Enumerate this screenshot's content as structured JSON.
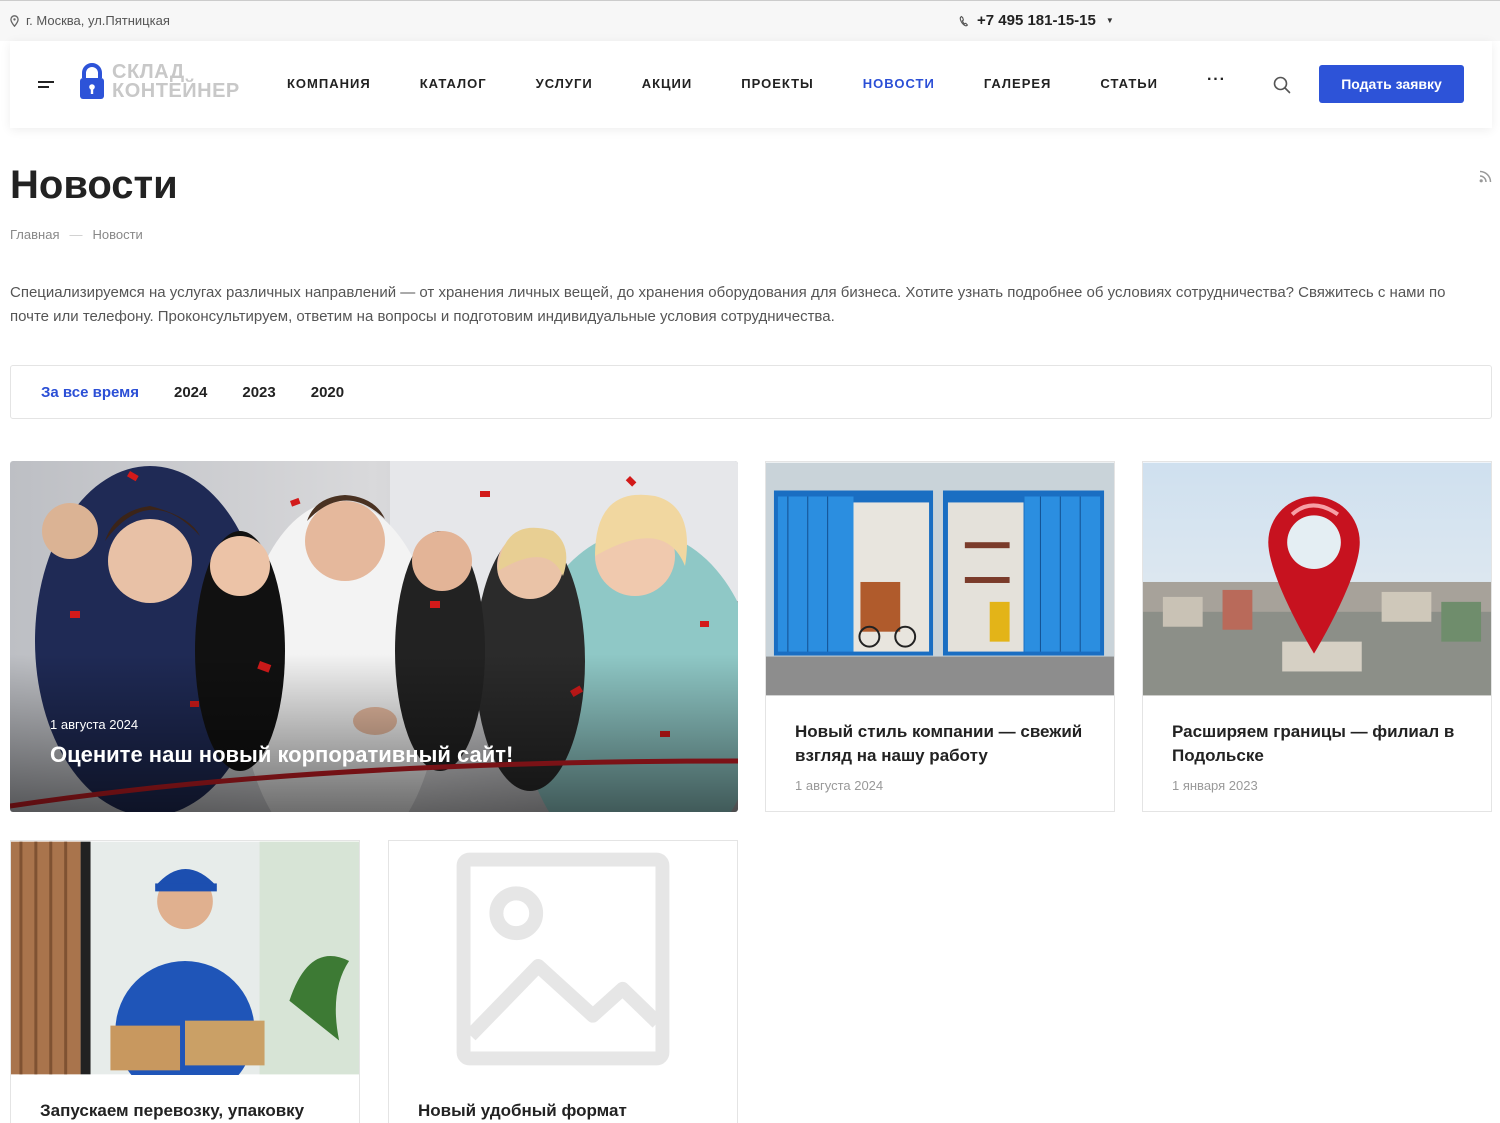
{
  "topbar": {
    "address": "г. Москва, ул.Пятницкая",
    "phone": "+7 495 181-15-15"
  },
  "header": {
    "logo_line1": "СКЛАД",
    "logo_line2": "КОНТЕЙНЕР",
    "nav": [
      {
        "label": "КОМПАНИЯ"
      },
      {
        "label": "КАТАЛОГ"
      },
      {
        "label": "УСЛУГИ"
      },
      {
        "label": "АКЦИИ"
      },
      {
        "label": "ПРОЕКТЫ"
      },
      {
        "label": "НОВОСТИ",
        "active": true
      },
      {
        "label": "ГАЛЕРЕЯ"
      },
      {
        "label": "СТАТЬИ"
      }
    ],
    "more_label": "···",
    "cta_label": "Подать заявку",
    "accent_color": "#2d53d8"
  },
  "page": {
    "title": "Новости",
    "breadcrumb": {
      "home": "Главная",
      "sep": "—",
      "current": "Новости"
    },
    "intro": "Специализируемся на услугах различных направлений — от хранения личных вещей, до хранения оборудования для бизнеса. Хотите узнать подробнее об условиях сотрудничества? Свяжитесь с нами по почте или телефону. Проконсультируем, ответим на вопросы и подготовим индивидуальные условия сотрудничества."
  },
  "filter": {
    "all": "За все время",
    "y2024": "2024",
    "y2023": "2023",
    "y2020": "2020"
  },
  "news": {
    "featured": {
      "date": "1 августа 2024",
      "title": "Оцените наш новый корпоративный сайт!"
    },
    "item2": {
      "title": "Новый стиль компании — свежий взгляд на нашу работу",
      "date": "1 августа 2024"
    },
    "item3": {
      "title": "Расширяем границы — филиал в Подольске",
      "date": "1 января 2023"
    },
    "item4": {
      "title": "Запускаем перевозку, упаковку"
    },
    "item5": {
      "title": "Новый удобный формат"
    }
  }
}
